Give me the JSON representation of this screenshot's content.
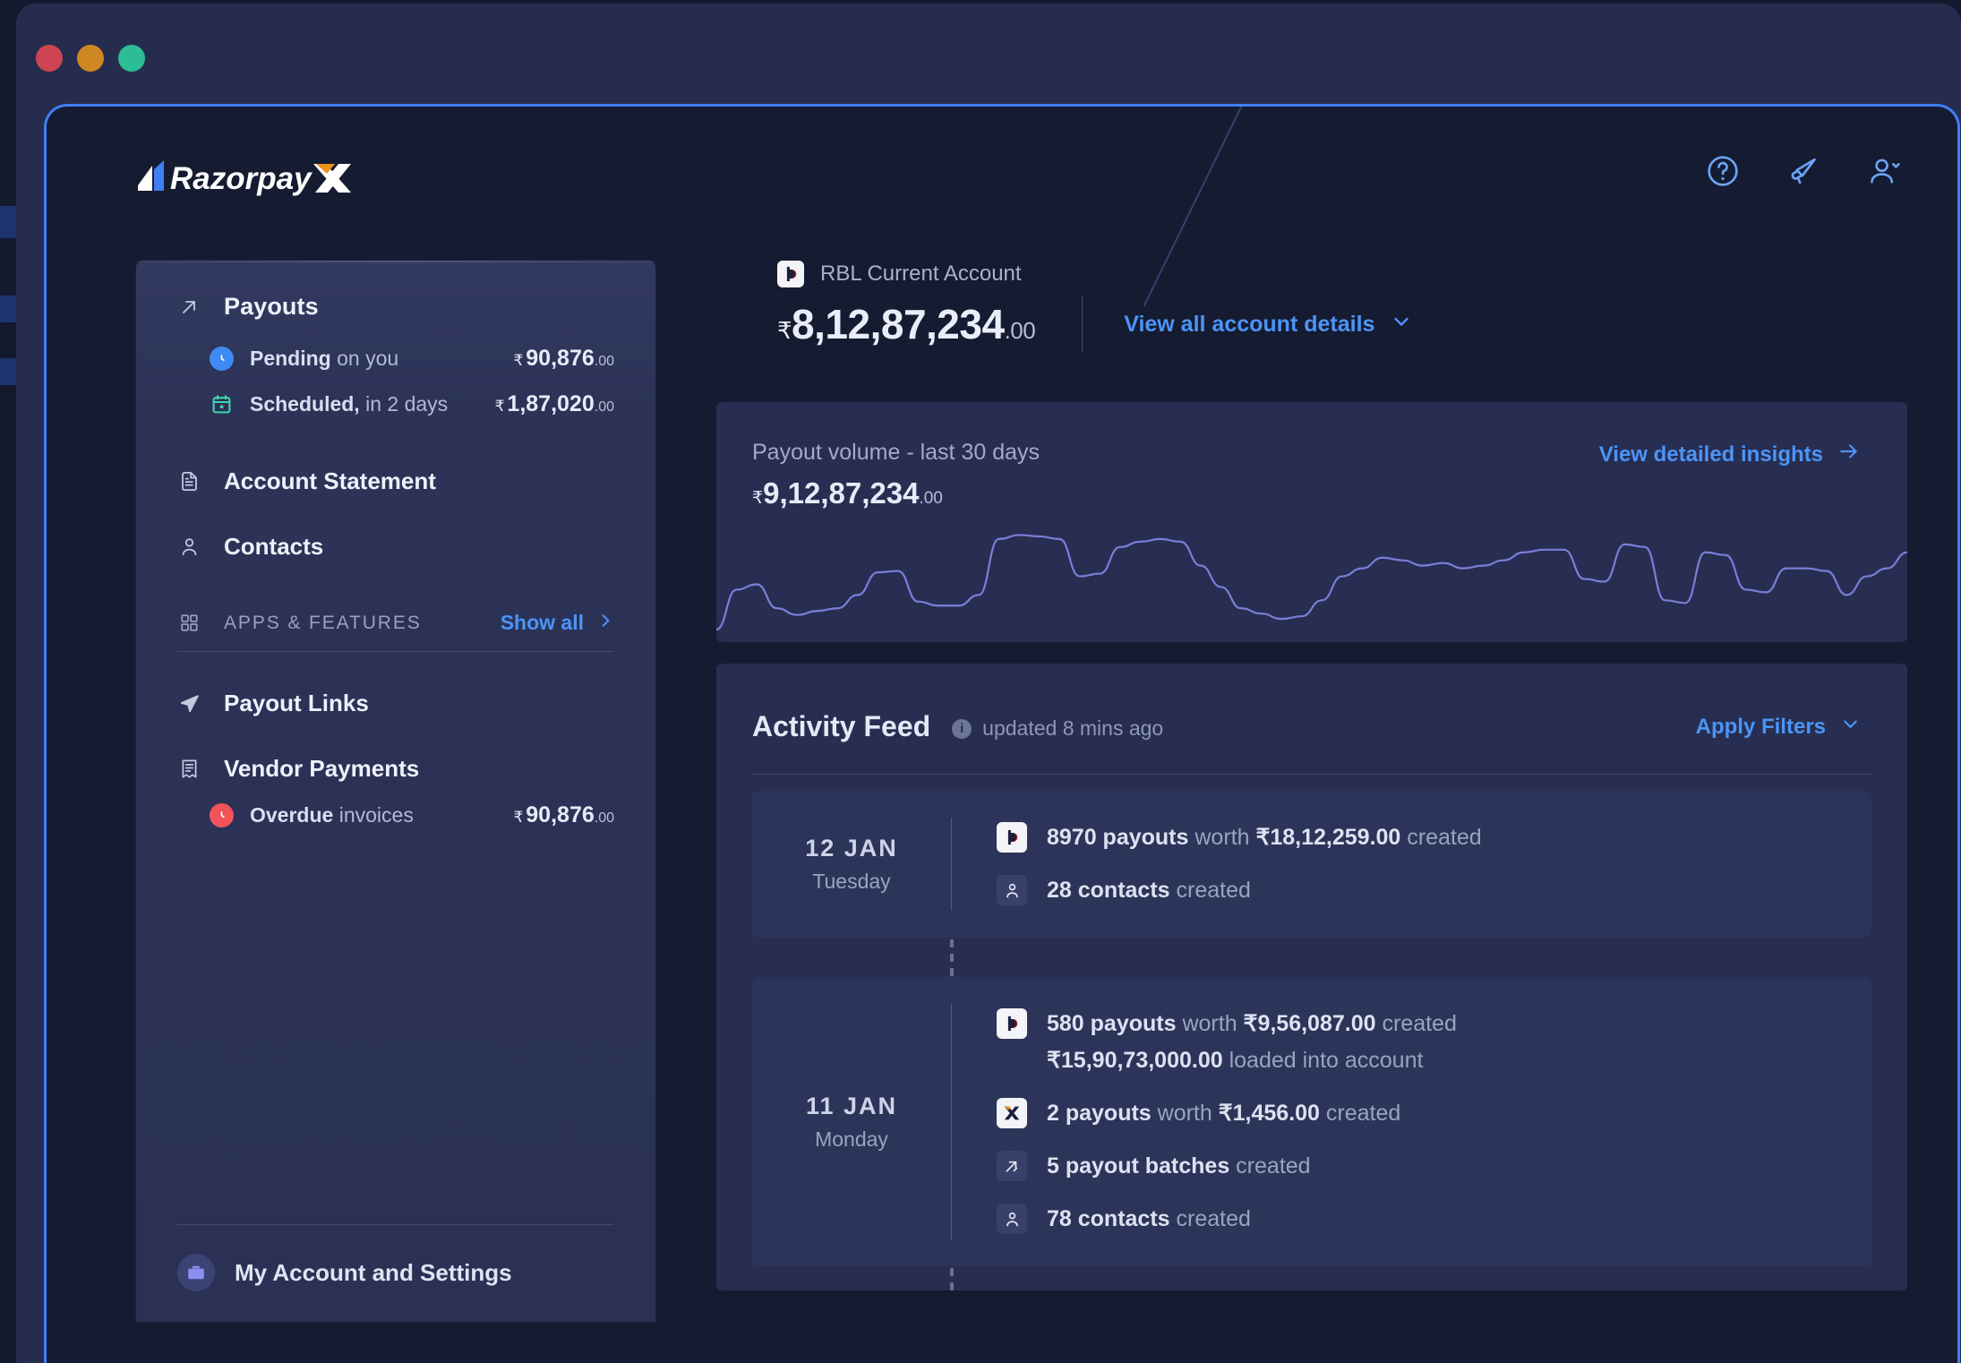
{
  "window": {
    "traffic_lights": [
      "close",
      "minimize",
      "maximize"
    ]
  },
  "brand": {
    "name": "RazorpayX"
  },
  "header": {
    "icons": [
      {
        "name": "help-icon",
        "label": "Help"
      },
      {
        "name": "announcement-icon",
        "label": "Announcements"
      },
      {
        "name": "account-menu-icon",
        "label": "Account"
      }
    ]
  },
  "sidebar": {
    "payouts": {
      "label": "Payouts",
      "sub_items": [
        {
          "label_bold": "Pending",
          "label_rest": " on you",
          "currency": "₹",
          "amount": "90,876",
          "decimals": ".00",
          "badge": "clock-icon",
          "badge_color": "#3d8bf2"
        },
        {
          "label_bold": "Scheduled,",
          "label_rest": " in 2 days",
          "currency": "₹",
          "amount": "1,87,020",
          "decimals": ".00",
          "badge": "calendar-icon",
          "badge_color": "#3fd6ae"
        }
      ]
    },
    "items": [
      {
        "label": "Account Statement",
        "icon": "document-icon"
      },
      {
        "label": "Contacts",
        "icon": "person-icon"
      }
    ],
    "apps_section": {
      "title": "APPS & FEATURES",
      "show_all": "Show all",
      "icon": "grid-icon"
    },
    "apps": [
      {
        "label": "Payout Links",
        "icon": "send-icon"
      },
      {
        "label": "Vendor Payments",
        "icon": "invoice-icon"
      }
    ],
    "overdue": {
      "label_bold": "Overdue",
      "label_rest": " invoices",
      "currency": "₹",
      "amount": "90,876",
      "decimals": ".00",
      "badge": "alert-clock-icon",
      "badge_color": "#f2535b"
    },
    "account_settings": {
      "label": "My Account and Settings",
      "icon": "briefcase-icon"
    }
  },
  "account": {
    "bank_name": "RBL Current Account",
    "bank_logo": "rbl-logo-icon",
    "currency": "₹",
    "balance": "8,12,87,234",
    "decimals": ".00",
    "view_details": "View all account details",
    "chevron": "chevron-down-icon"
  },
  "payout_volume": {
    "title": "Payout volume",
    "subtitle": " - last 30 days",
    "currency": "₹",
    "amount": "9,12,87,234",
    "decimals": ".00",
    "link": "View detailed insights",
    "link_icon": "arrow-right-icon"
  },
  "chart_data": {
    "type": "line",
    "title": "Payout volume - last 30 days",
    "xlabel": "",
    "ylabel": "",
    "grid": false,
    "legend": "none",
    "line_color": "#7b7ed8",
    "x": [
      0,
      1,
      2,
      3,
      4,
      5,
      6,
      7,
      8,
      9,
      10,
      11,
      12,
      13,
      14,
      15,
      16,
      17,
      18,
      19,
      20,
      21,
      22,
      23,
      24,
      25,
      26,
      27,
      28,
      29,
      30,
      31,
      32,
      33,
      34,
      35,
      36,
      37,
      38,
      39,
      40,
      41,
      42,
      43,
      44,
      45,
      46,
      47,
      48,
      49,
      50,
      51,
      52,
      53,
      54,
      55,
      56,
      57,
      58,
      59
    ],
    "values": [
      4,
      34,
      38,
      20,
      15,
      18,
      20,
      30,
      47,
      48,
      25,
      22,
      22,
      30,
      72,
      75,
      74,
      72,
      44,
      46,
      66,
      70,
      72,
      70,
      52,
      36,
      20,
      16,
      12,
      14,
      26,
      44,
      50,
      58,
      56,
      52,
      54,
      50,
      52,
      56,
      62,
      64,
      64,
      42,
      40,
      68,
      66,
      26,
      24,
      62,
      60,
      34,
      32,
      50,
      50,
      48,
      30,
      44,
      50,
      62
    ],
    "ylim": [
      0,
      80
    ]
  },
  "activity_feed": {
    "title": "Activity Feed",
    "updated": "updated 8 mins ago",
    "info_icon": "info-icon",
    "filters": "Apply Filters",
    "filters_chevron": "chevron-down-icon",
    "groups": [
      {
        "day": "12 JAN",
        "weekday": "Tuesday",
        "rows": [
          {
            "icon": "rbl-logo-icon",
            "icon_style": "light",
            "parts": [
              {
                "t": "8970 payouts",
                "b": true
              },
              {
                "t": " worth ",
                "b": false
              },
              {
                "t": "₹18,12,259.00",
                "b": true
              },
              {
                "t": " created",
                "b": false
              }
            ]
          },
          {
            "icon": "person-icon",
            "icon_style": "dark",
            "parts": [
              {
                "t": "28 contacts",
                "b": true
              },
              {
                "t": " created",
                "b": false
              }
            ]
          }
        ]
      },
      {
        "day": "11 JAN",
        "weekday": "Monday",
        "rows": [
          {
            "icon": "rbl-logo-icon",
            "icon_style": "light",
            "parts": [
              {
                "t": "580 payouts",
                "b": true
              },
              {
                "t": " worth ",
                "b": false
              },
              {
                "t": "₹9,56,087.00",
                "b": true
              },
              {
                "t": " created",
                "b": false
              }
            ],
            "sub_parts": [
              {
                "t": "₹15,90,73,000.00",
                "b": true
              },
              {
                "t": " loaded into account",
                "b": false
              }
            ]
          },
          {
            "icon": "razorpayx-mark-icon",
            "icon_style": "light",
            "parts": [
              {
                "t": "2 payouts",
                "b": true
              },
              {
                "t": " worth ",
                "b": false
              },
              {
                "t": "₹1,456.00",
                "b": true
              },
              {
                "t": " created",
                "b": false
              }
            ]
          },
          {
            "icon": "batch-arrow-icon",
            "icon_style": "dark",
            "parts": [
              {
                "t": "5 payout batches",
                "b": true
              },
              {
                "t": " created",
                "b": false
              }
            ]
          },
          {
            "icon": "person-icon",
            "icon_style": "dark",
            "parts": [
              {
                "t": "78 contacts",
                "b": true
              },
              {
                "t": " created",
                "b": false
              }
            ]
          }
        ]
      }
    ]
  },
  "colors": {
    "accent_blue": "#4c94f7",
    "border_blue": "#3f7ff5",
    "page_bg": "#151b31",
    "card_bg": "#272e51",
    "sidebar_bg": "#2c3357",
    "chart_line": "#7b7ed8",
    "green": "#3fd6ae",
    "red": "#f2535b"
  }
}
